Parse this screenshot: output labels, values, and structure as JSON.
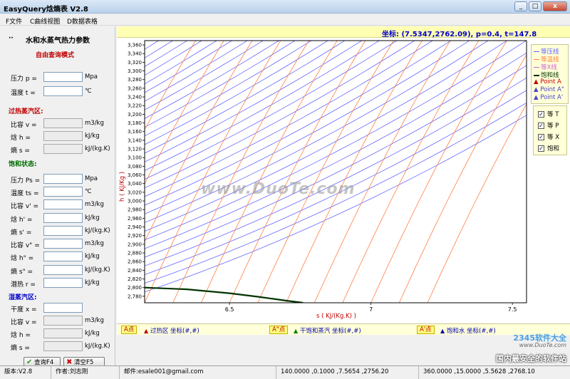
{
  "window": {
    "title": "EasyQuery焓熵表 V2.8",
    "minimize": "_",
    "maximize": "□",
    "close": "x"
  },
  "menu": {
    "items": [
      "F文件",
      "C曲线视图",
      "D数据表格"
    ]
  },
  "panel": {
    "header_mark": "··",
    "title": "水和水蒸气热力参数",
    "mode": "自由查询模式",
    "inputs": [
      {
        "label": "压力 p =",
        "unit": "Mpa",
        "value": ""
      },
      {
        "label": "温度 t =",
        "unit": "℃",
        "value": ""
      }
    ],
    "superheated": {
      "title": "过热蒸汽区:",
      "rows": [
        {
          "label": "比容 v =",
          "unit": "m3/kg",
          "value": ""
        },
        {
          "label": "焓   h =",
          "unit": "kJ/kg",
          "value": ""
        },
        {
          "label": "熵   s =",
          "unit": "kJ/(kg.K)",
          "value": ""
        }
      ]
    },
    "saturated": {
      "title": "饱和状态:",
      "rows": [
        {
          "label": "压力 Ps =",
          "unit": "Mpa",
          "value": ""
        },
        {
          "label": "温度 ts =",
          "unit": "℃",
          "value": ""
        },
        {
          "label": "比容 v' =",
          "unit": "m3/kg",
          "value": ""
        },
        {
          "label": "焓   h' =",
          "unit": "kJ/kg",
          "value": ""
        },
        {
          "label": "熵   s' =",
          "unit": "kJ/(kg.K)",
          "value": ""
        },
        {
          "label": "比容 v\" =",
          "unit": "m3/kg",
          "value": ""
        },
        {
          "label": "焓   h\" =",
          "unit": "kJ/kg",
          "value": ""
        },
        {
          "label": "熵   s\" =",
          "unit": "kJ/(kg.K)",
          "value": ""
        },
        {
          "label": "潜热 r =",
          "unit": "kJ/kg",
          "value": ""
        }
      ]
    },
    "wet": {
      "title": "湿蒸汽区:",
      "rows": [
        {
          "label": "干度 x =",
          "unit": "",
          "value": ""
        },
        {
          "label": "比容 v =",
          "unit": "m3/kg",
          "value": ""
        },
        {
          "label": "焓   h =",
          "unit": "kJ/kg",
          "value": ""
        },
        {
          "label": "熵   s =",
          "unit": "kJ/(kg.K)",
          "value": ""
        }
      ]
    },
    "query_button": "查询F4",
    "clear_button": "清空F5"
  },
  "coord_readout": "坐标: (7.5347,2762.09), p=0.4, t=147.8",
  "legend": {
    "items": [
      {
        "label": "等压线",
        "color": "#6666ff",
        "kind": "line"
      },
      {
        "label": "等温线",
        "color": "#ff8040",
        "kind": "line"
      },
      {
        "label": "等X线",
        "color": "#cc66cc",
        "kind": "line"
      },
      {
        "label": "饱和线",
        "color": "#003300",
        "kind": "line"
      },
      {
        "label": "Point A",
        "color": "#c00000",
        "kind": "tri"
      },
      {
        "label": "Point A\"",
        "color": "#4444cc",
        "kind": "tri"
      },
      {
        "label": "Point A'",
        "color": "#4444cc",
        "kind": "tri"
      }
    ]
  },
  "toggles": [
    {
      "label": "等 T",
      "checked": true
    },
    {
      "label": "等 P",
      "checked": true
    },
    {
      "label": "等 X",
      "checked": true
    },
    {
      "label": "饱和",
      "checked": true
    }
  ],
  "points_bar": {
    "a": {
      "tag": "A点",
      "text": "过热区 坐标(#,#)"
    },
    "a2": {
      "tag": "A\"点",
      "text": "干饱和蒸汽 坐标(#,#)"
    },
    "a1": {
      "tag": "A'点",
      "text": "饱和水 坐标(#,#)"
    }
  },
  "status": {
    "version": "版本:V2.8",
    "author": "作者:刘志刚",
    "email": "邮件:esale001@gmail.com",
    "point1": "140.0000 ,0.1000 ,7.5654 ,2756.20",
    "point2": "360.0000 ,15.0000 ,5.5628 ,2768.10"
  },
  "watermark": "www.DuoTe.com",
  "badge": {
    "brand": "2345软件大全",
    "url": "www.DuoTe.com",
    "slogan": "国内最安全的软件站"
  },
  "chart_data": {
    "type": "line",
    "title": "",
    "xlabel": "s ( KJ/(Kg.K) )",
    "ylabel": "h ( KJ/Kg )",
    "xlim": [
      6.2,
      7.55
    ],
    "ylim": [
      2765,
      3370
    ],
    "x_ticks": [
      6.5,
      7,
      7.5
    ],
    "x_tick_labels": [
      "6.5",
      "7",
      "7.5"
    ],
    "y_ticks": [
      2780,
      2800,
      2820,
      2840,
      2860,
      2880,
      2900,
      2920,
      2940,
      2960,
      2980,
      3000,
      3020,
      3040,
      3060,
      3080,
      3100,
      3120,
      3140,
      3160,
      3180,
      3200,
      3220,
      3240,
      3260,
      3280,
      3300,
      3320,
      3340,
      3360
    ],
    "y_tick_labels": [
      "2,780",
      "2,800",
      "2,820",
      "2,840",
      "2,860",
      "2,880",
      "2,900",
      "2,920",
      "2,940",
      "2,960",
      "2,980",
      "3,000",
      "3,020",
      "3,040",
      "3,060",
      "3,080",
      "3,100",
      "3,120",
      "3,140",
      "3,160",
      "3,180",
      "3,200",
      "3,220",
      "3,240",
      "3,260",
      "3,280",
      "3,300",
      "3,320",
      "3,340",
      "3,360"
    ],
    "grid": true,
    "saturation_line": {
      "s": [
        6.2,
        6.35,
        6.5,
        6.6,
        6.7,
        6.76
      ],
      "h": [
        2800,
        2796,
        2787,
        2779,
        2770,
        2765
      ]
    },
    "isobar_family": {
      "color": "#6666ff",
      "count": 34,
      "h_at_xmin_start": 2790,
      "h_step": 20,
      "slope_h_per_s": [
        260,
        520
      ]
    },
    "isotherm_family": {
      "color": "#ff8040",
      "count": 14,
      "slope_h_per_s": 1450
    }
  }
}
